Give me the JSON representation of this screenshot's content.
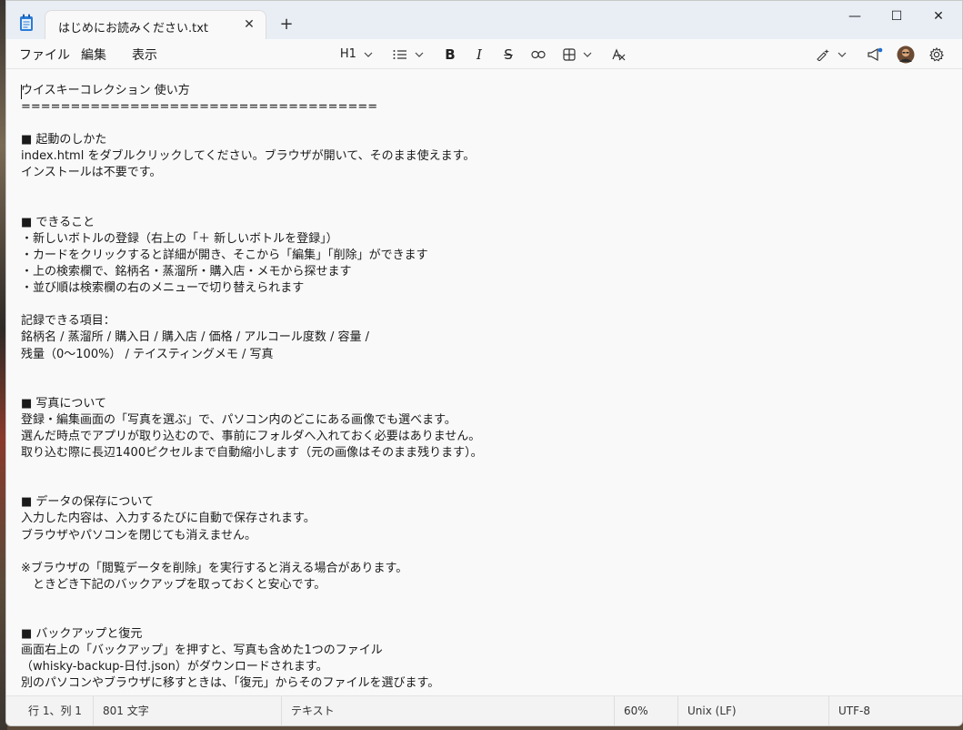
{
  "window": {
    "tab_title": "はじめにお読みください.txt",
    "tab_close_glyph": "✕",
    "new_tab_glyph": "+",
    "minimize_glyph": "—",
    "maximize_glyph": "☐",
    "close_glyph": "✕"
  },
  "menu": {
    "file": "ファイル",
    "edit": "編集",
    "view": "表示"
  },
  "toolbar": {
    "heading": "H1",
    "bold_glyph": "B",
    "italic_glyph": "I",
    "strike_glyph": "S"
  },
  "icons": {
    "app": "notepad-icon",
    "list": "list-icon",
    "link": "link-icon",
    "table": "table-icon",
    "clear_format": "clear-format-icon",
    "copilot": "copilot-pen-icon",
    "announcement": "megaphone-icon",
    "avatar": "avatar",
    "settings": "gear-icon"
  },
  "editor": {
    "lines": [
      "ウイスキーコレクション 使い方",
      "====================================",
      "",
      "■ 起動のしかた",
      "index.html をダブルクリックしてください。ブラウザが開いて、そのまま使えます。",
      "インストールは不要です。",
      "",
      "",
      "■ できること",
      "・新しいボトルの登録（右上の「＋ 新しいボトルを登録」）",
      "・カードをクリックすると詳細が開き、そこから「編集」「削除」ができます",
      "・上の検索欄で、銘柄名・蒸溜所・購入店・メモから探せます",
      "・並び順は検索欄の右のメニューで切り替えられます",
      "",
      "記録できる項目：",
      "銘柄名 / 蒸溜所 / 購入日 / 購入店 / 価格 / アルコール度数 / 容量 /",
      "残量（0〜100%） / テイスティングメモ / 写真",
      "",
      "",
      "■ 写真について",
      "登録・編集画面の「写真を選ぶ」で、パソコン内のどこにある画像でも選べます。",
      "選んだ時点でアプリが取り込むので、事前にフォルダへ入れておく必要はありません。",
      "取り込む際に長辺1400ピクセルまで自動縮小します（元の画像はそのまま残ります）。",
      "",
      "",
      "■ データの保存について",
      "入力した内容は、入力するたびに自動で保存されます。",
      "ブラウザやパソコンを閉じても消えません。",
      "",
      "※ブラウザの「閲覧データを削除」を実行すると消える場合があります。",
      "　ときどき下記のバックアップを取っておくと安心です。",
      "",
      "",
      "■ バックアップと復元",
      "画面右上の「バックアップ」を押すと、写真も含めた1つのファイル",
      "（whisky-backup-日付.json）がダウンロードされます。",
      "別のパソコンやブラウザに移すときは、「復元」からそのファイルを選びます。"
    ]
  },
  "status": {
    "position": "行 1、列 1",
    "char_count": "801 文字",
    "mode": "テキスト",
    "zoom": "60%",
    "line_ending": "Unix (LF)",
    "encoding": "UTF-8"
  }
}
